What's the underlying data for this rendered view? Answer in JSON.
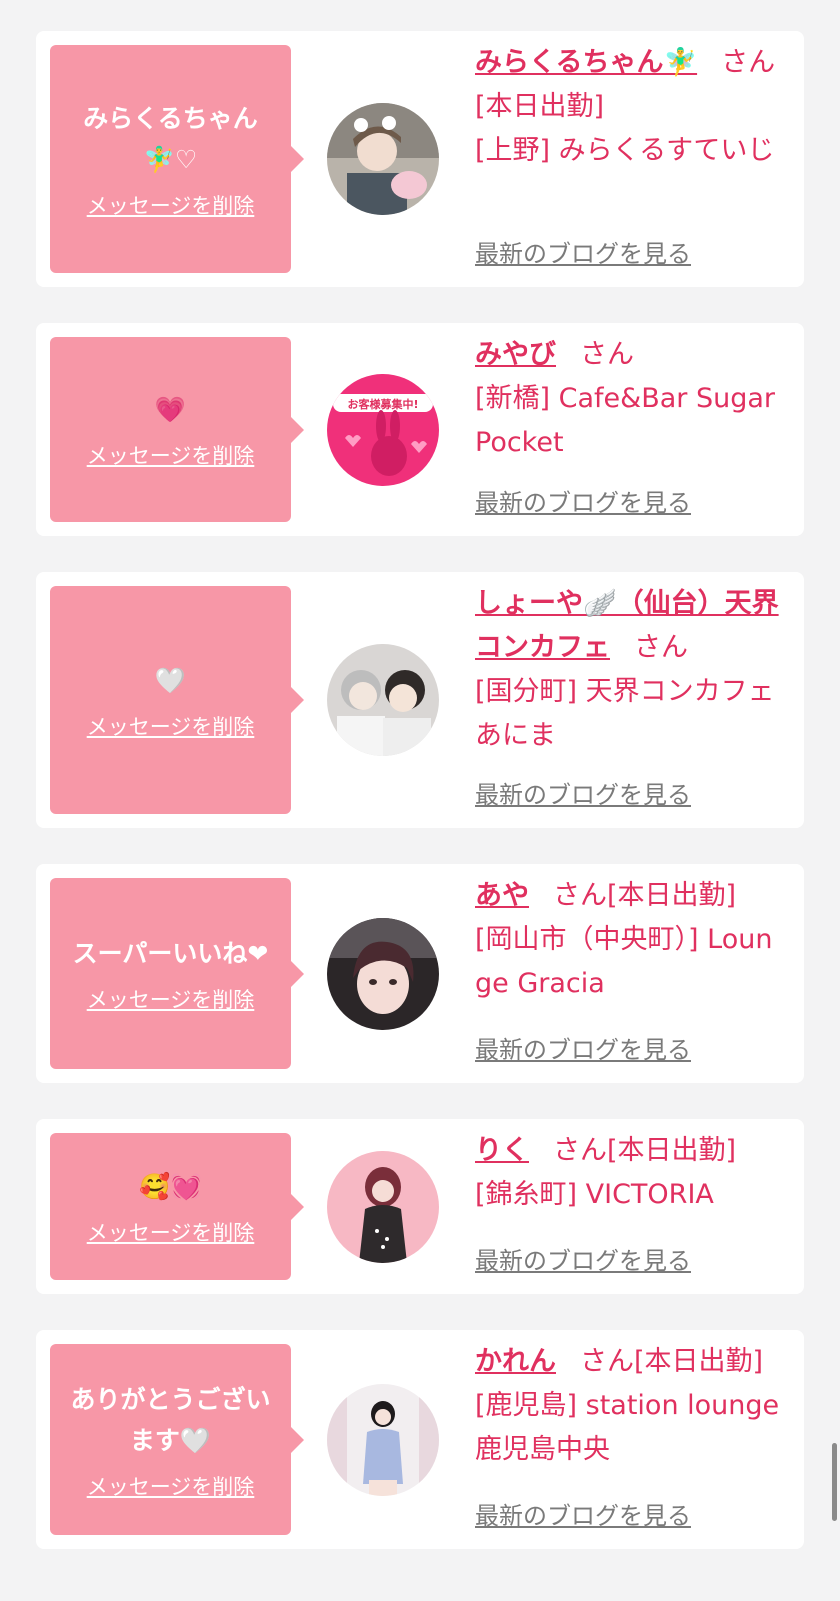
{
  "delete_label": "メッセージを削除",
  "blog_label": "最新のブログを見る",
  "san": "さん",
  "colors": {
    "bubble": "#f797a7",
    "name": "#e0305f",
    "card": "#ffffff",
    "bg": "#f3f3f4",
    "link_gray": "#7a7a7a"
  },
  "cards": [
    {
      "message": "みらくるちゃん🧚‍♂️♡",
      "name": "みらくるちゃん🧚‍♂️",
      "status": "[本日出勤]",
      "shop": "[上野] みらくるすていじ",
      "avatar_icon": "girl-photo-avatar"
    },
    {
      "message": "💗",
      "name": "みやび",
      "status": "",
      "shop": "[新橋] Cafe&Bar Sugar Pocket",
      "avatar_icon": "pink-rabbit-avatar"
    },
    {
      "message": "🤍",
      "name": "しょーや🪽（仙台）天界コンカフェ",
      "status": "",
      "shop": "[国分町] 天界コンカフェ あにま",
      "avatar_icon": "two-girls-photo-avatar"
    },
    {
      "message": "スーパーいいね❤",
      "name": "あや",
      "status": "[本日出勤]",
      "shop": "[岡山市（中央町）] Lounge Gracia",
      "avatar_icon": "girl-photo-avatar"
    },
    {
      "message": "🥰💓",
      "name": "りく",
      "status": "[本日出勤]",
      "shop": "[錦糸町] VICTORIA",
      "avatar_icon": "girl-photo-avatar"
    },
    {
      "message": "ありがとうございます🤍",
      "name": "かれん",
      "status": "[本日出勤]",
      "shop": "[鹿児島] station lounge 鹿児島中央",
      "avatar_icon": "girl-photo-avatar"
    }
  ]
}
